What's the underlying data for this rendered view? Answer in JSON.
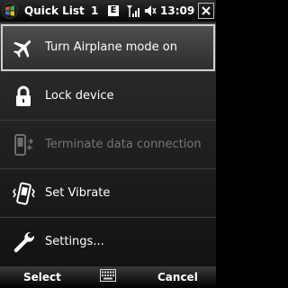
{
  "status_bar": {
    "title": "Quick List",
    "count": "1",
    "badge": "E",
    "time": "13:09",
    "icons": [
      "windows-start-icon",
      "e-badge",
      "signal-icon",
      "speaker-icon",
      "close-icon"
    ]
  },
  "menu": {
    "items": [
      {
        "label": "Turn Airplane mode on",
        "icon": "airplane-icon",
        "state": "selected"
      },
      {
        "label": "Lock device",
        "icon": "lock-icon",
        "state": "normal"
      },
      {
        "label": "Terminate data connection",
        "icon": "phone-connection-icon",
        "state": "disabled"
      },
      {
        "label": "Set Vibrate",
        "icon": "vibrate-icon",
        "state": "normal"
      },
      {
        "label": "Settings...",
        "icon": "wrench-icon",
        "state": "normal"
      }
    ]
  },
  "softkeys": {
    "left": "Select",
    "right": "Cancel",
    "center_icon": "keyboard-icon"
  },
  "colors": {
    "background": "#000000",
    "text": "#ffffff",
    "disabled_text": "#777777",
    "selection_outline": "#cfcfcf"
  }
}
